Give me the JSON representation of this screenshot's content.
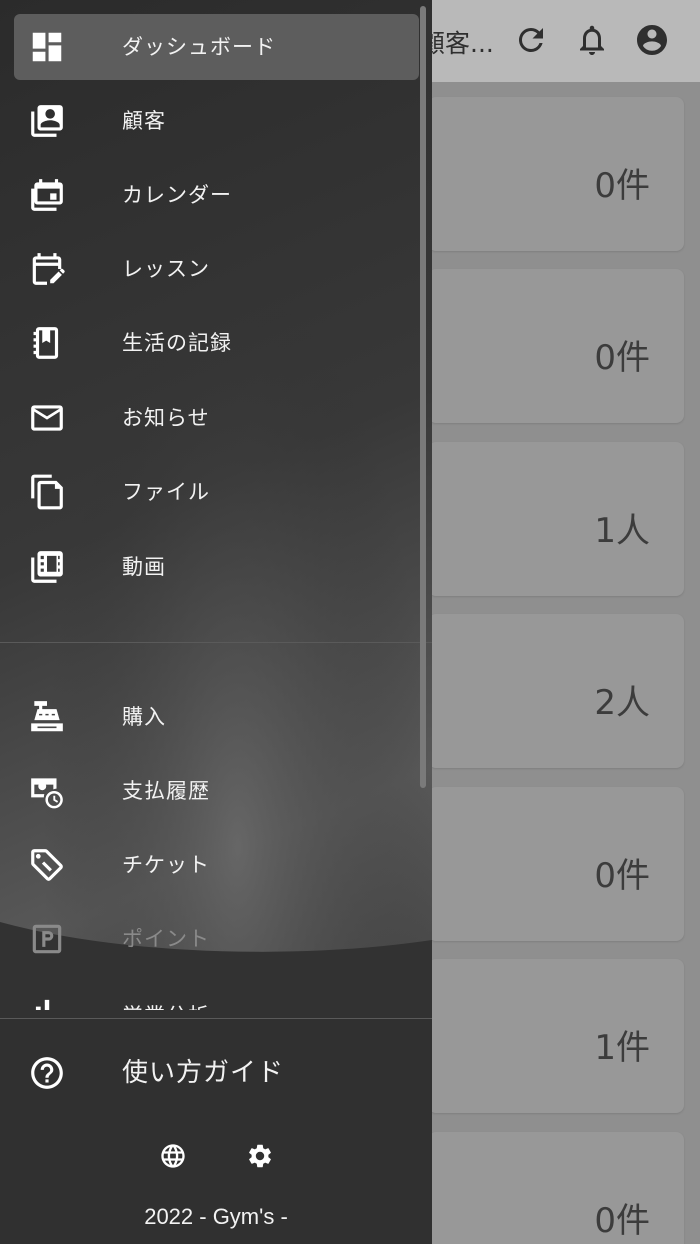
{
  "app_bar": {
    "title": "顧客..."
  },
  "cards": [
    {
      "value": "0件"
    },
    {
      "value": "0件"
    },
    {
      "value": "1人"
    },
    {
      "value": "2人"
    },
    {
      "value": "0件"
    },
    {
      "value": "1件"
    },
    {
      "value": "0件"
    }
  ],
  "drawer": {
    "main_items": [
      {
        "label": "ダッシュボード",
        "icon": "dashboard-icon",
        "active": true
      },
      {
        "label": "顧客",
        "icon": "contacts-icon"
      },
      {
        "label": "カレンダー",
        "icon": "calendar-icon"
      },
      {
        "label": "レッスン",
        "icon": "edit-calendar-icon"
      },
      {
        "label": "生活の記録",
        "icon": "notebook-icon"
      },
      {
        "label": "お知らせ",
        "icon": "mail-icon"
      },
      {
        "label": "ファイル",
        "icon": "file-icon"
      },
      {
        "label": "動画",
        "icon": "video-library-icon"
      }
    ],
    "secondary_items": [
      {
        "label": "購入",
        "icon": "cash-register-icon"
      },
      {
        "label": "支払履歴",
        "icon": "payment-history-icon"
      },
      {
        "label": "チケット",
        "icon": "ticket-icon"
      },
      {
        "label": "ポイント",
        "icon": "parking-points-icon",
        "disabled": true
      },
      {
        "label": "営業分析",
        "icon": "bar-chart-icon"
      }
    ],
    "guide_label": "使い方ガイド",
    "copyright": "2022 - Gym's -"
  }
}
